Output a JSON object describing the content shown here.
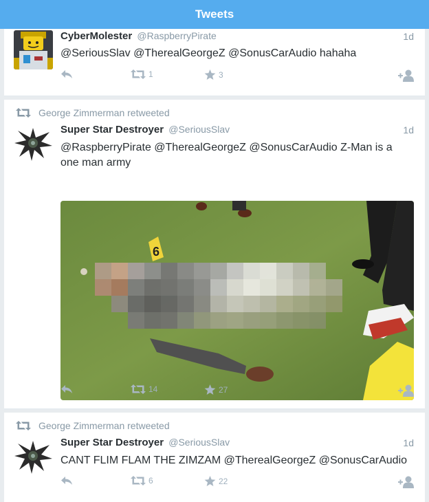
{
  "header": {
    "title": "Tweets"
  },
  "tweets": [
    {
      "name": "CyberMolester",
      "handle": "@RaspberryPirate",
      "time": "1d",
      "text": "@SeriousSlav @TherealGeorgeZ @SonusCarAudio hahaha",
      "retweets": "1",
      "favorites": "3",
      "icons": {
        "reply": "reply-icon",
        "retweet": "retweet-icon",
        "favorite": "star-icon",
        "follow": "follow-icon"
      }
    },
    {
      "context": "George Zimmerman retweeted",
      "name": "Super Star Destroyer",
      "handle": "@SeriousSlav",
      "time": "1d",
      "text_line1": "@RaspberryPirate @TherealGeorgeZ @SonusCarAudio Z-Man is a",
      "text_line2": "one man army",
      "photo_label": "6",
      "retweets": "14",
      "favorites": "27"
    },
    {
      "context": "George Zimmerman retweeted",
      "name": "Super Star Destroyer",
      "handle": "@SeriousSlav",
      "time": "1d",
      "text": "CANT FLIM FLAM THE ZIMZAM @TherealGeorgeZ @SonusCarAudio",
      "retweets": "6",
      "favorites": "22"
    }
  ],
  "colors": {
    "brand": "#55acee",
    "muted": "#8899a6",
    "action": "#9fb0bd"
  }
}
